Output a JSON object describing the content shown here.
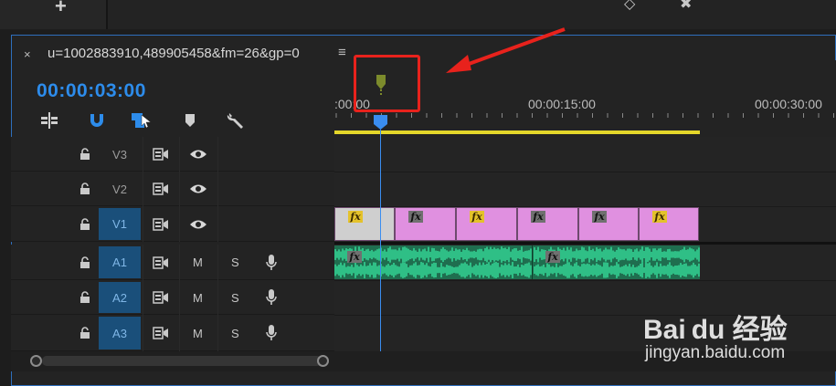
{
  "window": {
    "top_icon": "plus-icon",
    "top_glyph_left": "◇",
    "top_glyph_right": "✖"
  },
  "sequence": {
    "close_glyph": "×",
    "name": "u=1002883910,489905458&fm=26&gp=0",
    "menu_glyph": "≡",
    "timecode": "00:00:03:00"
  },
  "tools": [
    "insert-edit-icon",
    "snap-magnet-icon",
    "linked-selection-icon",
    "add-marker-icon",
    "settings-wrench-icon"
  ],
  "ruler": {
    "labels": [
      ":00:00",
      "00:00:15:00",
      "00:00:30:00"
    ]
  },
  "tracks": {
    "video": [
      {
        "id": "V3",
        "active": false
      },
      {
        "id": "V2",
        "active": false
      },
      {
        "id": "V1",
        "active": true
      }
    ],
    "audio": [
      {
        "id": "A1",
        "active": true,
        "mute": "M",
        "solo": "S"
      },
      {
        "id": "A2",
        "active": true,
        "mute": "M",
        "solo": "S"
      },
      {
        "id": "A3",
        "active": true,
        "mute": "M",
        "solo": "S"
      }
    ]
  },
  "clips": {
    "fx_label": "fx",
    "video_clip_colors": [
      "#cfcfcf",
      "#e090e0",
      "#e090e0",
      "#e090e0",
      "#e090e0",
      "#e090e0"
    ],
    "audio_color": "#2fbf86"
  },
  "colors": {
    "accent": "#2d8ceb",
    "work_area": "#e4d62a",
    "marker": "#7c8b2c",
    "annotation": "#e8221c"
  },
  "watermark": {
    "brand": "Bai du 经验",
    "url": "jingyan.baidu.com"
  }
}
